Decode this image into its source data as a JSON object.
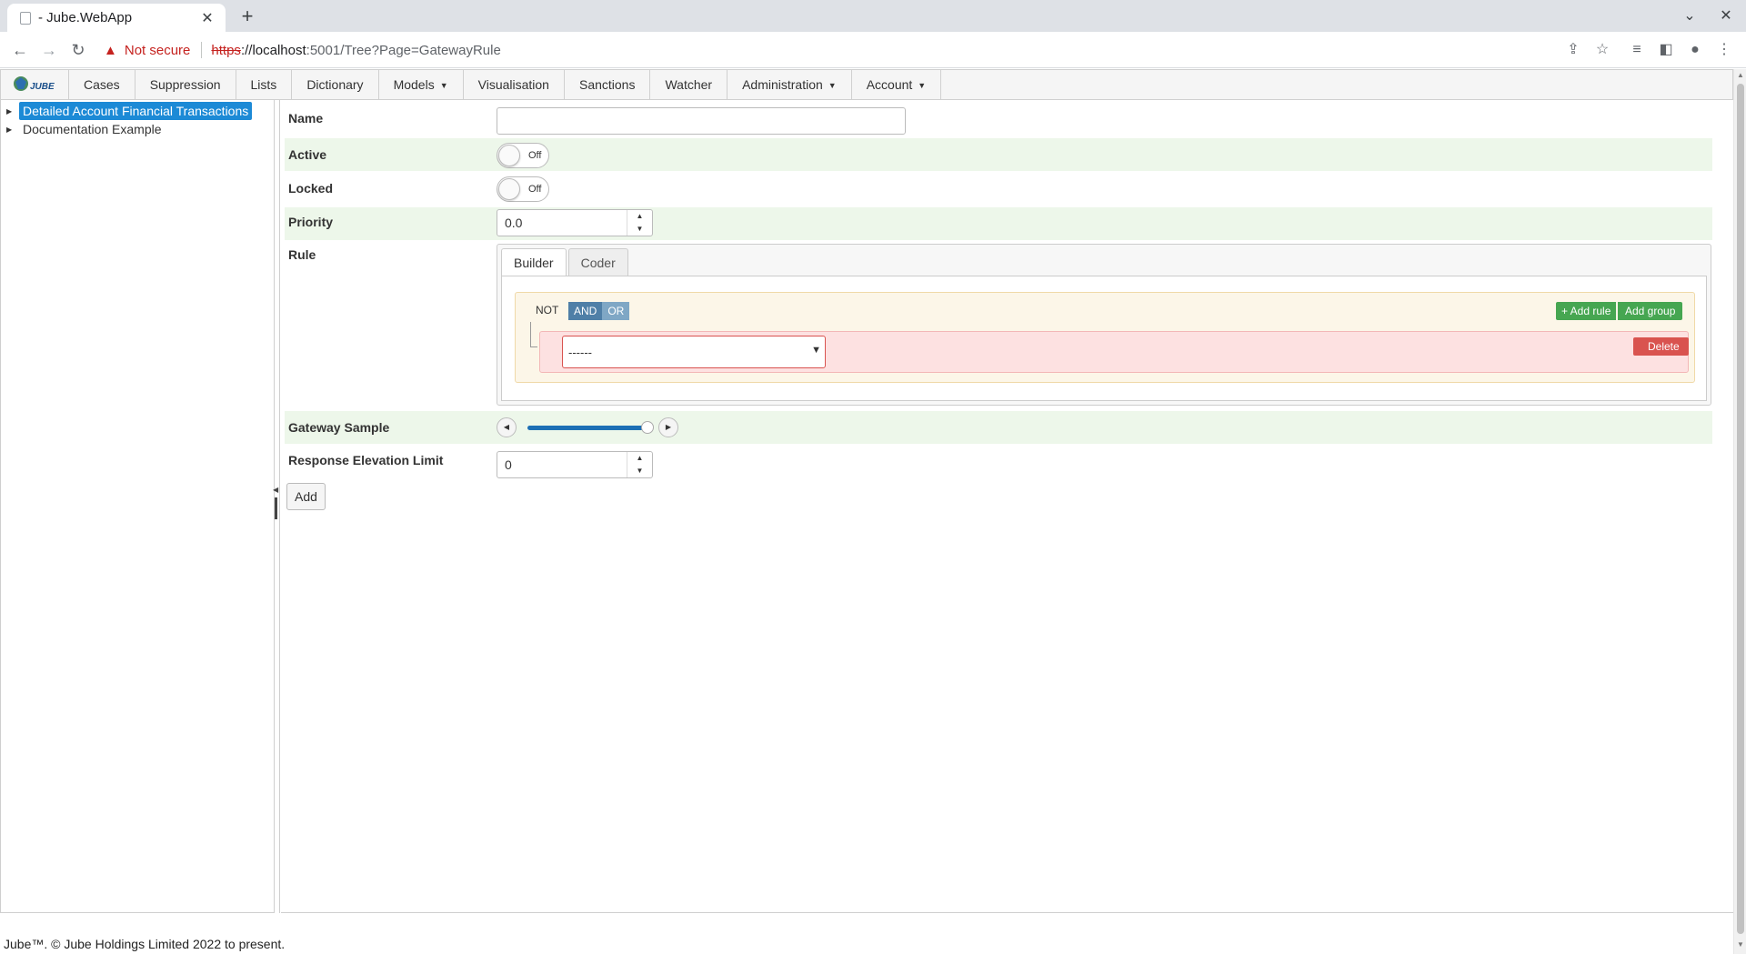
{
  "browser": {
    "tab_title": "- Jube.WebApp",
    "security_label": "Not secure",
    "url_scheme": "https",
    "url_host": "://localhost",
    "url_rest": ":5001/Tree?Page=GatewayRule"
  },
  "navbar": {
    "logo_text": "JUBE",
    "items": [
      {
        "label": "Cases",
        "dropdown": false
      },
      {
        "label": "Suppression",
        "dropdown": false
      },
      {
        "label": "Lists",
        "dropdown": false
      },
      {
        "label": "Dictionary",
        "dropdown": false
      },
      {
        "label": "Models",
        "dropdown": true
      },
      {
        "label": "Visualisation",
        "dropdown": false
      },
      {
        "label": "Sanctions",
        "dropdown": false
      },
      {
        "label": "Watcher",
        "dropdown": false
      },
      {
        "label": "Administration",
        "dropdown": true
      },
      {
        "label": "Account",
        "dropdown": true
      }
    ]
  },
  "tree": {
    "nodes": [
      {
        "label": "Detailed Account Financial Transactions",
        "selected": true
      },
      {
        "label": "Documentation Example",
        "selected": false
      }
    ]
  },
  "form": {
    "name_label": "Name",
    "name_value": "",
    "active_label": "Active",
    "active_state": "Off",
    "locked_label": "Locked",
    "locked_state": "Off",
    "priority_label": "Priority",
    "priority_value": "0.0",
    "rule_label": "Rule",
    "rule_tabs": [
      "Builder",
      "Coder"
    ],
    "builder": {
      "not_label": "NOT",
      "and_label": "AND",
      "or_label": "OR",
      "add_rule_label": "+ Add rule",
      "add_group_label": "Add group",
      "field_select_value": "------",
      "delete_label": "Delete"
    },
    "gateway_sample_label": "Gateway Sample",
    "gateway_sample_fraction": 0.96,
    "response_elevation_limit_label": "Response Elevation Limit",
    "response_elevation_limit_value": "0",
    "add_button_label": "Add"
  },
  "footer": {
    "text": "Jube™. © Jube Holdings Limited 2022 to present."
  },
  "colors": {
    "selected_node": "#1c8ad6",
    "shaded_row": "#edf7ea",
    "add_green": "#46a651",
    "delete_red": "#d9534f",
    "slider_fill": "#1c6fb5"
  }
}
